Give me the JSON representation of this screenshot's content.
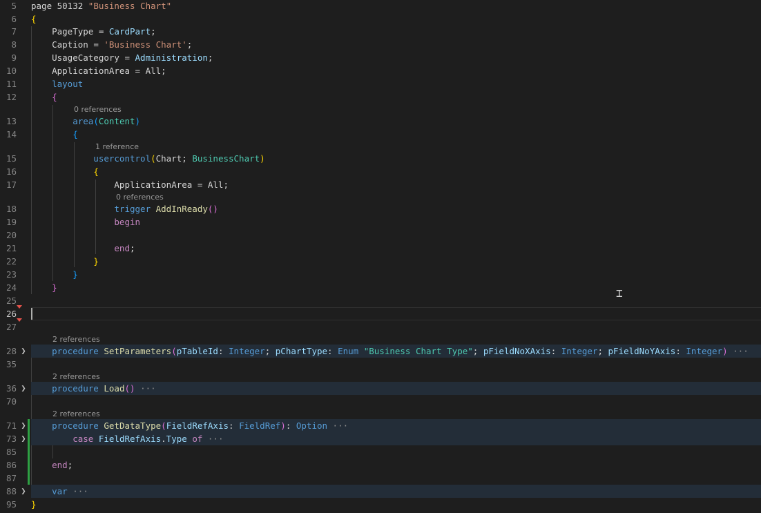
{
  "editor": {
    "line_numbers": [
      "5",
      "6",
      "7",
      "8",
      "9",
      "10",
      "11",
      "12",
      "13",
      "14",
      "15",
      "16",
      "17",
      "18",
      "19",
      "20",
      "21",
      "22",
      "23",
      "24",
      "25",
      "26",
      "27",
      "28",
      "35",
      "36",
      "70",
      "71",
      "73",
      "85",
      "86",
      "87",
      "88",
      "95"
    ],
    "active_line": "26",
    "code_lenses": {
      "l13": "0 references",
      "l15": "1 reference",
      "l18": "0 references",
      "l28": "2 references",
      "l36": "2 references",
      "l71": "2 references"
    },
    "code": {
      "l5": [
        {
          "t": "page",
          "c": "plain"
        },
        {
          "t": " 50132",
          "c": "plain"
        },
        {
          "t": " \"Business Chart\"",
          "c": "str"
        }
      ],
      "l6": [
        {
          "t": "{",
          "c": "b1"
        }
      ],
      "l7": [
        {
          "t": "    PageType",
          "c": "plain"
        },
        {
          "t": " = ",
          "c": "plain"
        },
        {
          "t": "CardPart",
          "c": "prop"
        },
        {
          "t": ";",
          "c": "plain"
        }
      ],
      "l8": [
        {
          "t": "    Caption",
          "c": "plain"
        },
        {
          "t": " = ",
          "c": "plain"
        },
        {
          "t": "'Business Chart'",
          "c": "str"
        },
        {
          "t": ";",
          "c": "plain"
        }
      ],
      "l9": [
        {
          "t": "    UsageCategory",
          "c": "plain"
        },
        {
          "t": " = ",
          "c": "plain"
        },
        {
          "t": "Administration",
          "c": "prop"
        },
        {
          "t": ";",
          "c": "plain"
        }
      ],
      "l10": [
        {
          "t": "    ApplicationArea",
          "c": "plain"
        },
        {
          "t": " = ",
          "c": "plain"
        },
        {
          "t": "All",
          "c": "plain"
        },
        {
          "t": ";",
          "c": "plain"
        }
      ],
      "l11": [
        {
          "t": "    layout",
          "c": "kw"
        }
      ],
      "l12": [
        {
          "t": "    ",
          "c": "plain"
        },
        {
          "t": "{",
          "c": "b2"
        }
      ],
      "l13": [
        {
          "t": "        area",
          "c": "kw"
        },
        {
          "t": "(",
          "c": "b3"
        },
        {
          "t": "Content",
          "c": "type"
        },
        {
          "t": ")",
          "c": "b3"
        }
      ],
      "l14": [
        {
          "t": "        ",
          "c": "plain"
        },
        {
          "t": "{",
          "c": "b3"
        }
      ],
      "l15": [
        {
          "t": "            usercontrol",
          "c": "kw"
        },
        {
          "t": "(",
          "c": "b1"
        },
        {
          "t": "Chart",
          "c": "plain"
        },
        {
          "t": "; ",
          "c": "plain"
        },
        {
          "t": "BusinessChart",
          "c": "type"
        },
        {
          "t": ")",
          "c": "b1"
        }
      ],
      "l16": [
        {
          "t": "            ",
          "c": "plain"
        },
        {
          "t": "{",
          "c": "b1"
        }
      ],
      "l17": [
        {
          "t": "                ApplicationArea",
          "c": "plain"
        },
        {
          "t": " = ",
          "c": "plain"
        },
        {
          "t": "All",
          "c": "plain"
        },
        {
          "t": ";",
          "c": "plain"
        }
      ],
      "l18": [
        {
          "t": "                trigger",
          "c": "kw"
        },
        {
          "t": " AddInReady",
          "c": "fn"
        },
        {
          "t": "()",
          "c": "b2"
        }
      ],
      "l19": [
        {
          "t": "                begin",
          "c": "ctrl"
        }
      ],
      "l20": [
        {
          "t": "",
          "c": "plain"
        }
      ],
      "l21": [
        {
          "t": "                end",
          "c": "ctrl"
        },
        {
          "t": ";",
          "c": "plain"
        }
      ],
      "l22": [
        {
          "t": "            ",
          "c": "plain"
        },
        {
          "t": "}",
          "c": "b1"
        }
      ],
      "l23": [
        {
          "t": "        ",
          "c": "plain"
        },
        {
          "t": "}",
          "c": "b3"
        }
      ],
      "l24": [
        {
          "t": "    ",
          "c": "plain"
        },
        {
          "t": "}",
          "c": "b2"
        }
      ],
      "l25": [
        {
          "t": "",
          "c": "plain"
        }
      ],
      "l26": [
        {
          "t": "",
          "c": "plain"
        }
      ],
      "l27": [
        {
          "t": "",
          "c": "plain"
        }
      ],
      "l28": [
        {
          "t": "    procedure",
          "c": "kw"
        },
        {
          "t": " SetParameters",
          "c": "fn"
        },
        {
          "t": "(",
          "c": "b2"
        },
        {
          "t": "pTableId",
          "c": "prop"
        },
        {
          "t": ": ",
          "c": "plain"
        },
        {
          "t": "Integer",
          "c": "kw"
        },
        {
          "t": "; ",
          "c": "plain"
        },
        {
          "t": "pChartType",
          "c": "prop"
        },
        {
          "t": ": ",
          "c": "plain"
        },
        {
          "t": "Enum",
          "c": "kw"
        },
        {
          "t": " \"Business Chart Type\"",
          "c": "type"
        },
        {
          "t": "; ",
          "c": "plain"
        },
        {
          "t": "pFieldNoXAxis",
          "c": "prop"
        },
        {
          "t": ": ",
          "c": "plain"
        },
        {
          "t": "Integer",
          "c": "kw"
        },
        {
          "t": "; ",
          "c": "plain"
        },
        {
          "t": "pFieldNoYAxis",
          "c": "prop"
        },
        {
          "t": ": ",
          "c": "plain"
        },
        {
          "t": "Integer",
          "c": "kw"
        },
        {
          "t": ")",
          "c": "b2"
        },
        {
          "t": " ···",
          "c": "ell"
        }
      ],
      "l35": [
        {
          "t": "",
          "c": "plain"
        }
      ],
      "l36": [
        {
          "t": "    procedure",
          "c": "kw"
        },
        {
          "t": " Load",
          "c": "fn"
        },
        {
          "t": "()",
          "c": "b2"
        },
        {
          "t": " ···",
          "c": "ell"
        }
      ],
      "l70": [
        {
          "t": "",
          "c": "plain"
        }
      ],
      "l71": [
        {
          "t": "    procedure",
          "c": "kw"
        },
        {
          "t": " GetDataType",
          "c": "fn"
        },
        {
          "t": "(",
          "c": "b2"
        },
        {
          "t": "FieldRefAxis",
          "c": "prop"
        },
        {
          "t": ": ",
          "c": "plain"
        },
        {
          "t": "FieldRef",
          "c": "kw"
        },
        {
          "t": ")",
          "c": "b2"
        },
        {
          "t": ": ",
          "c": "plain"
        },
        {
          "t": "Option",
          "c": "kw"
        },
        {
          "t": " ···",
          "c": "ell"
        }
      ],
      "l73": [
        {
          "t": "        case",
          "c": "ctrl"
        },
        {
          "t": " FieldRefAxis",
          "c": "prop"
        },
        {
          "t": ".",
          "c": "plain"
        },
        {
          "t": "Type",
          "c": "prop"
        },
        {
          "t": " of",
          "c": "ctrl"
        },
        {
          "t": " ···",
          "c": "ell"
        }
      ],
      "l85": [
        {
          "t": "",
          "c": "plain"
        }
      ],
      "l86": [
        {
          "t": "    end",
          "c": "ctrl"
        },
        {
          "t": ";",
          "c": "plain"
        }
      ],
      "l87": [
        {
          "t": "",
          "c": "plain"
        }
      ],
      "l88": [
        {
          "t": "    var",
          "c": "kw"
        },
        {
          "t": " ···",
          "c": "ell"
        }
      ],
      "l95": [
        {
          "t": "}",
          "c": "b1"
        }
      ]
    }
  }
}
